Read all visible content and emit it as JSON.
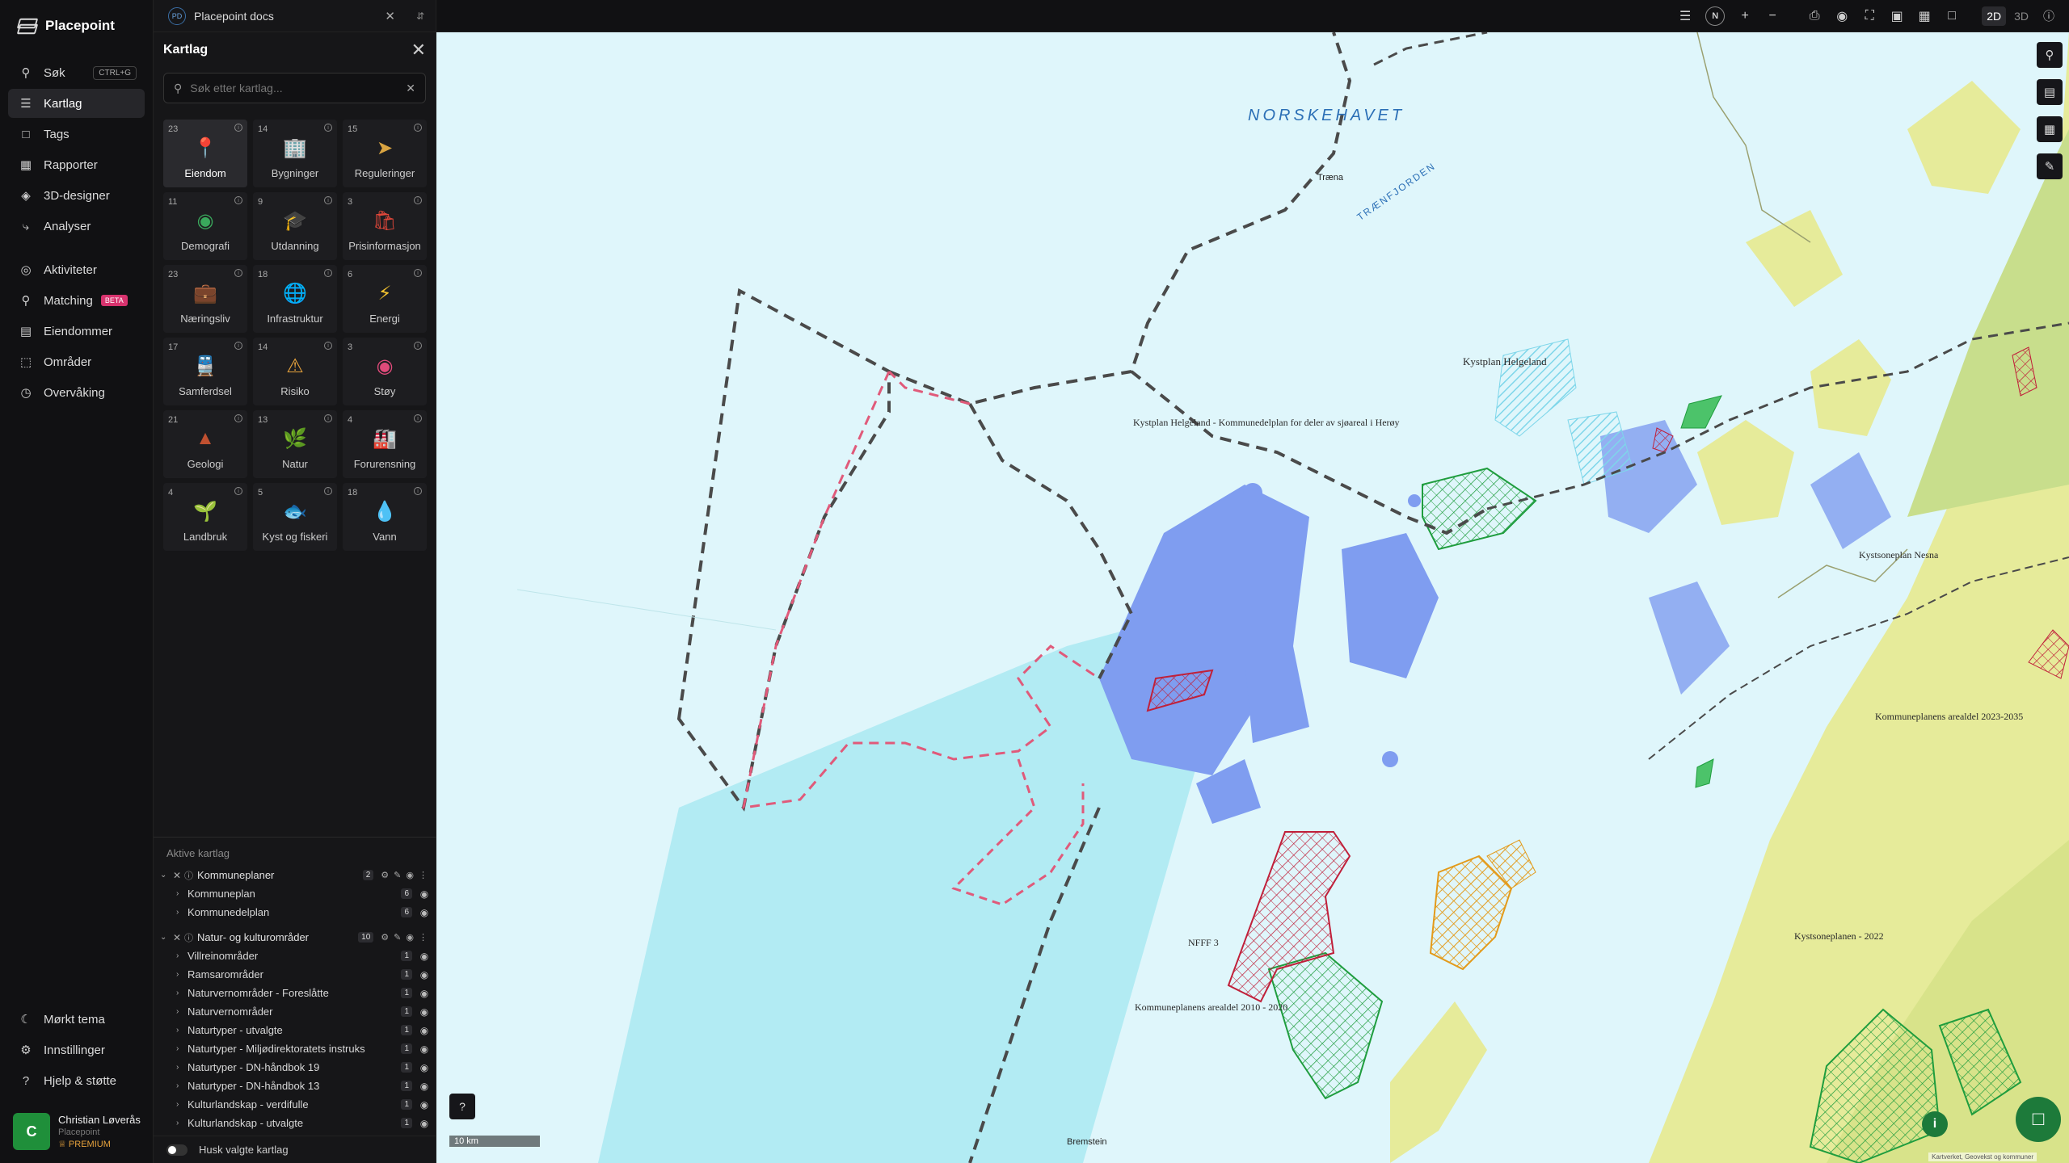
{
  "app": {
    "name": "Placepoint"
  },
  "nav": {
    "items": [
      {
        "key": "sok",
        "label": "Søk",
        "icon": "search-icon",
        "shortcut": "CTRL+G"
      },
      {
        "key": "kartlag",
        "label": "Kartlag",
        "icon": "layers-icon",
        "active": true
      },
      {
        "key": "tags",
        "label": "Tags",
        "icon": "bookmark-icon"
      },
      {
        "key": "rapporter",
        "label": "Rapporter",
        "icon": "chart-icon"
      },
      {
        "key": "3d",
        "label": "3D-designer",
        "icon": "cube-icon"
      },
      {
        "key": "analyser",
        "label": "Analyser",
        "icon": "lightning-icon"
      },
      {
        "key": "aktiviteter",
        "label": "Aktiviteter",
        "icon": "activity-icon"
      },
      {
        "key": "matching",
        "label": "Matching",
        "icon": "match-icon",
        "badge": "BETA"
      },
      {
        "key": "eiendommer",
        "label": "Eiendommer",
        "icon": "building-icon"
      },
      {
        "key": "omrader",
        "label": "Områder",
        "icon": "area-icon"
      },
      {
        "key": "overvaking",
        "label": "Overvåking",
        "icon": "watch-icon"
      }
    ],
    "bottom": [
      {
        "key": "dark",
        "label": "Mørkt tema",
        "icon": "moon-icon"
      },
      {
        "key": "settings",
        "label": "Innstillinger",
        "icon": "gear-icon"
      },
      {
        "key": "help",
        "label": "Hjelp & støtte",
        "icon": "help-icon"
      }
    ],
    "user": {
      "initial": "C",
      "name": "Christian Løverås",
      "org": "Placepoint",
      "plan": "PREMIUM"
    }
  },
  "doc": {
    "badge": "PD",
    "title": "Placepoint docs"
  },
  "panel": {
    "title": "Kartlag",
    "search_placeholder": "Søk etter kartlag...",
    "categories": [
      {
        "count": "23",
        "label": "Eiendom",
        "icon": "pin-icon",
        "selected": true
      },
      {
        "count": "14",
        "label": "Bygninger",
        "icon": "building-icon"
      },
      {
        "count": "15",
        "label": "Reguleringer",
        "icon": "signpost-icon"
      },
      {
        "count": "11",
        "label": "Demografi",
        "icon": "people-icon"
      },
      {
        "count": "9",
        "label": "Utdanning",
        "icon": "graduation-icon"
      },
      {
        "count": "3",
        "label": "Prisinformasjon",
        "icon": "shopping-bag-icon"
      },
      {
        "count": "23",
        "label": "Næringsliv",
        "icon": "briefcase-icon"
      },
      {
        "count": "18",
        "label": "Infrastruktur",
        "icon": "globe-icon"
      },
      {
        "count": "6",
        "label": "Energi",
        "icon": "bolt-icon"
      },
      {
        "count": "17",
        "label": "Samferdsel",
        "icon": "train-icon"
      },
      {
        "count": "14",
        "label": "Risiko",
        "icon": "warning-icon"
      },
      {
        "count": "3",
        "label": "Støy",
        "icon": "noise-icon"
      },
      {
        "count": "21",
        "label": "Geologi",
        "icon": "terrain-icon"
      },
      {
        "count": "13",
        "label": "Natur",
        "icon": "leaf-icon"
      },
      {
        "count": "4",
        "label": "Forurensning",
        "icon": "factory-icon"
      },
      {
        "count": "4",
        "label": "Landbruk",
        "icon": "plant-icon"
      },
      {
        "count": "5",
        "label": "Kyst og fiskeri",
        "icon": "fish-icon"
      },
      {
        "count": "18",
        "label": "Vann",
        "icon": "water-drop-icon"
      }
    ],
    "active_title": "Aktive kartlag",
    "groups": [
      {
        "name": "Kommuneplaner",
        "count": "2",
        "layers": [
          {
            "name": "Kommuneplan",
            "count": "6"
          },
          {
            "name": "Kommunedelplan",
            "count": "6"
          }
        ]
      },
      {
        "name": "Natur- og kulturområder",
        "count": "10",
        "layers": [
          {
            "name": "Villreinområder",
            "count": "1"
          },
          {
            "name": "Ramsarområder",
            "count": "1"
          },
          {
            "name": "Naturvernområder - Foreslåtte",
            "count": "1"
          },
          {
            "name": "Naturvernområder",
            "count": "1"
          },
          {
            "name": "Naturtyper - utvalgte",
            "count": "1"
          },
          {
            "name": "Naturtyper - Miljødirektoratets instruks",
            "count": "1"
          },
          {
            "name": "Naturtyper - DN-håndbok 19",
            "count": "1"
          },
          {
            "name": "Naturtyper - DN-håndbok 13",
            "count": "1"
          },
          {
            "name": "Kulturlandskap - verdifulle",
            "count": "1"
          },
          {
            "name": "Kulturlandskap - utvalgte",
            "count": "1"
          }
        ]
      }
    ],
    "remember_label": "Husk valgte kartlag"
  },
  "toolbar": {
    "north": "N",
    "mode_2d": "2D",
    "mode_3d": "3D"
  },
  "map": {
    "sea_label": "NORSKEHAVET",
    "labels": [
      "Træna",
      "TRÆNFJORDEN",
      "Kystplan Helgeland",
      "Kystplan Helgeland - Kommunedelplan for deler av sjøareal i Herøy",
      "Kystsoneplan Nesna",
      "Kommuneplanens arealdel 2023-2035",
      "NFFF 3",
      "Kommuneplanens arealdel 2010 - 2020",
      "Bremstein",
      "Kystsoneplanen - 2022"
    ],
    "scale": "10 km",
    "attribution": "Kartverket, Geovekst og kommuner"
  },
  "colors": {
    "accent": "#1d7a3a",
    "sea": "#dff6fb",
    "land": "#e6eb9a",
    "plan_blue": "#7f9df0",
    "plan_red": "#c0203a",
    "plan_green": "#1f9d3e"
  }
}
